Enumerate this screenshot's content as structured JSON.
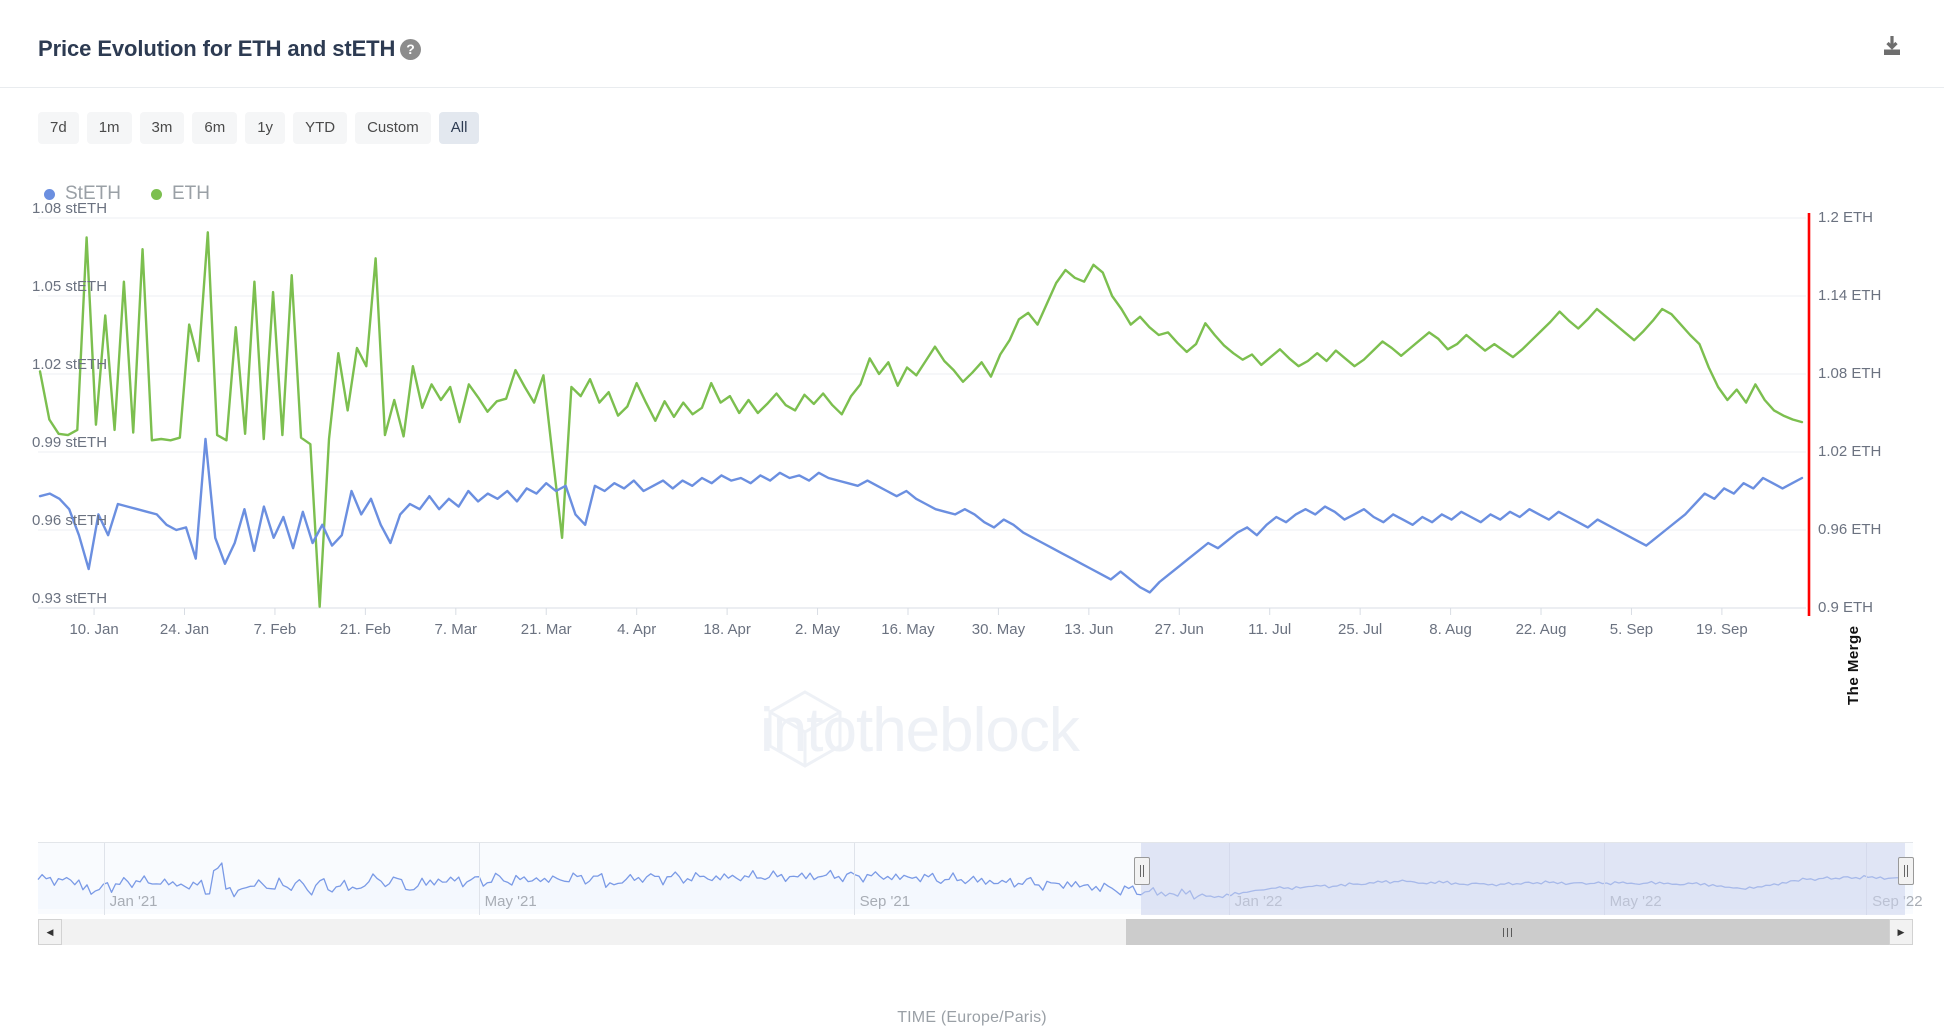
{
  "header": {
    "title": "Price Evolution for ETH and stETH",
    "help_icon": "question-mark-circle-icon",
    "download_icon": "download-icon"
  },
  "range_selector": {
    "options": [
      "7d",
      "1m",
      "3m",
      "6m",
      "1y",
      "YTD",
      "Custom",
      "All"
    ],
    "selected": "All"
  },
  "legend": [
    {
      "label": "StETH",
      "color": "#6b8fe0"
    },
    {
      "label": "ETH",
      "color": "#7cbf4f"
    }
  ],
  "watermark": "intotheblock",
  "annotation": {
    "label": "The Merge",
    "color": "#ff0000"
  },
  "navigator": {
    "tick_labels": [
      "Jan '21",
      "May '21",
      "Sep '21",
      "Jan '22",
      "May '22",
      "Sep '22"
    ],
    "left_arrow": "scroll-left-arrow-icon",
    "right_arrow": "scroll-right-arrow-icon"
  },
  "chart_data": {
    "type": "line",
    "title": "Price Evolution for ETH and stETH",
    "xlabel": "TIME (Europe/Paris)",
    "grid": true,
    "legend_position": "top-left",
    "x_tick_labels": [
      "10. Jan",
      "24. Jan",
      "7. Feb",
      "21. Feb",
      "7. Mar",
      "21. Mar",
      "4. Apr",
      "18. Apr",
      "2. May",
      "16. May",
      "30. May",
      "13. Jun",
      "27. Jun",
      "11. Jul",
      "25. Jul",
      "8. Aug",
      "22. Aug",
      "5. Sep",
      "19. Sep"
    ],
    "y_axis_left": {
      "label": "stETH",
      "tick_labels": [
        "1.08 stETH",
        "1.05 stETH",
        "1.02 stETH",
        "0.99 stETH",
        "0.96 stETH",
        "0.93 stETH"
      ],
      "ticks": [
        1.08,
        1.05,
        1.02,
        0.99,
        0.96,
        0.93
      ],
      "ylim": [
        0.93,
        1.08
      ]
    },
    "y_axis_right": {
      "label": "ETH",
      "tick_labels": [
        "1.2 ETH",
        "1.14 ETH",
        "1.08 ETH",
        "1.02 ETH",
        "0.96 ETH",
        "0.9 ETH"
      ],
      "ticks": [
        1.2,
        1.14,
        1.08,
        1.02,
        0.96,
        0.9
      ],
      "ylim": [
        0.9,
        1.2
      ]
    },
    "annotations": [
      {
        "label": "The Merge",
        "x_position": "19. Sep",
        "color": "#ff0000",
        "type": "vertical-line"
      }
    ],
    "series": [
      {
        "name": "ETH",
        "color": "#7cbf4f",
        "axis": "right",
        "values": [
          1.082,
          1.045,
          1.034,
          1.033,
          1.037,
          1.185,
          1.041,
          1.125,
          1.037,
          1.151,
          1.035,
          1.176,
          1.029,
          1.03,
          1.029,
          1.031,
          1.118,
          1.09,
          1.189,
          1.033,
          1.029,
          1.116,
          1.034,
          1.151,
          1.03,
          1.143,
          1.033,
          1.156,
          1.031,
          1.026,
          0.901,
          1.03,
          1.096,
          1.052,
          1.1,
          1.086,
          1.169,
          1.033,
          1.06,
          1.032,
          1.086,
          1.054,
          1.072,
          1.06,
          1.07,
          1.043,
          1.072,
          1.062,
          1.051,
          1.059,
          1.061,
          1.083,
          1.07,
          1.058,
          1.079,
          1.016,
          0.954,
          1.07,
          1.063,
          1.076,
          1.058,
          1.066,
          1.048,
          1.055,
          1.073,
          1.058,
          1.044,
          1.059,
          1.047,
          1.058,
          1.049,
          1.054,
          1.073,
          1.058,
          1.063,
          1.05,
          1.06,
          1.05,
          1.057,
          1.065,
          1.056,
          1.052,
          1.064,
          1.057,
          1.065,
          1.056,
          1.049,
          1.063,
          1.072,
          1.092,
          1.08,
          1.089,
          1.071,
          1.085,
          1.079,
          1.09,
          1.101,
          1.09,
          1.083,
          1.074,
          1.081,
          1.089,
          1.078,
          1.095,
          1.106,
          1.122,
          1.127,
          1.118,
          1.134,
          1.15,
          1.16,
          1.154,
          1.151,
          1.164,
          1.158,
          1.14,
          1.13,
          1.118,
          1.124,
          1.116,
          1.11,
          1.112,
          1.104,
          1.097,
          1.103,
          1.119,
          1.11,
          1.102,
          1.096,
          1.091,
          1.095,
          1.087,
          1.093,
          1.099,
          1.092,
          1.086,
          1.09,
          1.096,
          1.09,
          1.098,
          1.092,
          1.086,
          1.091,
          1.098,
          1.105,
          1.1,
          1.094,
          1.1,
          1.106,
          1.112,
          1.107,
          1.099,
          1.103,
          1.11,
          1.104,
          1.098,
          1.103,
          1.098,
          1.093,
          1.099,
          1.106,
          1.113,
          1.12,
          1.128,
          1.121,
          1.115,
          1.122,
          1.13,
          1.124,
          1.118,
          1.112,
          1.106,
          1.113,
          1.121,
          1.13,
          1.126,
          1.118,
          1.11,
          1.103,
          1.085,
          1.07,
          1.06,
          1.068,
          1.058,
          1.072,
          1.06,
          1.052,
          1.048,
          1.045,
          1.043
        ]
      },
      {
        "name": "StETH",
        "color": "#6b8fe0",
        "axis": "left",
        "values": [
          0.973,
          0.974,
          0.972,
          0.968,
          0.958,
          0.945,
          0.966,
          0.958,
          0.97,
          0.969,
          0.968,
          0.967,
          0.966,
          0.962,
          0.96,
          0.961,
          0.949,
          0.995,
          0.957,
          0.947,
          0.955,
          0.968,
          0.952,
          0.969,
          0.957,
          0.965,
          0.953,
          0.967,
          0.955,
          0.962,
          0.954,
          0.958,
          0.975,
          0.966,
          0.972,
          0.962,
          0.955,
          0.966,
          0.97,
          0.968,
          0.973,
          0.968,
          0.972,
          0.969,
          0.975,
          0.971,
          0.974,
          0.972,
          0.975,
          0.971,
          0.976,
          0.974,
          0.978,
          0.975,
          0.977,
          0.966,
          0.962,
          0.977,
          0.975,
          0.978,
          0.976,
          0.979,
          0.975,
          0.977,
          0.979,
          0.976,
          0.979,
          0.977,
          0.98,
          0.978,
          0.981,
          0.979,
          0.98,
          0.978,
          0.981,
          0.979,
          0.982,
          0.98,
          0.981,
          0.979,
          0.982,
          0.98,
          0.979,
          0.978,
          0.977,
          0.979,
          0.977,
          0.975,
          0.973,
          0.975,
          0.972,
          0.97,
          0.968,
          0.967,
          0.966,
          0.968,
          0.966,
          0.963,
          0.961,
          0.964,
          0.962,
          0.959,
          0.957,
          0.955,
          0.953,
          0.951,
          0.949,
          0.947,
          0.945,
          0.943,
          0.941,
          0.944,
          0.941,
          0.938,
          0.936,
          0.94,
          0.943,
          0.946,
          0.949,
          0.952,
          0.955,
          0.953,
          0.956,
          0.959,
          0.961,
          0.958,
          0.962,
          0.965,
          0.963,
          0.966,
          0.968,
          0.966,
          0.969,
          0.967,
          0.964,
          0.966,
          0.968,
          0.965,
          0.963,
          0.966,
          0.964,
          0.962,
          0.965,
          0.963,
          0.966,
          0.964,
          0.967,
          0.965,
          0.963,
          0.966,
          0.964,
          0.967,
          0.965,
          0.968,
          0.966,
          0.964,
          0.967,
          0.965,
          0.963,
          0.961,
          0.964,
          0.962,
          0.96,
          0.958,
          0.956,
          0.954,
          0.957,
          0.96,
          0.963,
          0.966,
          0.97,
          0.974,
          0.972,
          0.976,
          0.974,
          0.978,
          0.976,
          0.98,
          0.978,
          0.976,
          0.978,
          0.98
        ]
      }
    ]
  },
  "navigator_series": {
    "name": "StETH",
    "color": "#7a9ae6",
    "fill": "#f4f8fe"
  }
}
